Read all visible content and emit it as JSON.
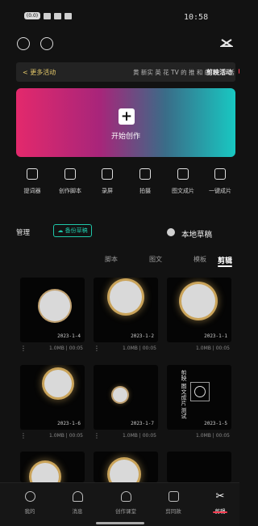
{
  "status_bar": {
    "time": "10:58",
    "icons": [
      "signal-icon",
      "wifi-icon",
      "battery-icon"
    ],
    "carrier_badge": "(0.0)"
  },
  "header": {
    "settings_icon": "settings-icon",
    "help_icon": "help-icon",
    "logo_icon": "capcut-logo-icon"
  },
  "notice": {
    "more_label": "< 更多活动",
    "message": "黄 新实 英 花 TV 的 推 和 的 我 手 活",
    "tag_label": "剪映活动"
  },
  "hero": {
    "create_label": "开始创作"
  },
  "tools": [
    {
      "label": "一键成片",
      "icon": "one-click-icon"
    },
    {
      "label": "图文成片",
      "icon": "text-to-video-icon"
    },
    {
      "label": "拍摄",
      "icon": "camera-icon"
    },
    {
      "label": "录屏",
      "icon": "screen-record-icon"
    },
    {
      "label": "创作脚本",
      "icon": "script-icon"
    },
    {
      "label": "提词器",
      "icon": "teleprompter-icon"
    }
  ],
  "drafts_section": {
    "title": "本地草稿",
    "cloud_label": "☁ 备份草稿",
    "manage_label": "管理"
  },
  "tabs": [
    "剪辑",
    "模板",
    "图文",
    "脚本"
  ],
  "active_tab": "剪辑",
  "drafts": [
    {
      "caption": "2023-1-1",
      "meta": "1.0MB | 00:05"
    },
    {
      "caption": "2023-1-2",
      "meta": "1.0MB | 00:05"
    },
    {
      "caption": "2023-1-4",
      "meta": "1.0MB | 00:05"
    },
    {
      "caption": "2023-1-5",
      "meta": "1.0MB | 00:05"
    },
    {
      "caption": "2023-1-7",
      "meta": "1.0MB | 00:05"
    },
    {
      "caption": "2023-1-6",
      "meta": "1.0MB | 00:05"
    }
  ],
  "doc_thumb_text": "剪映 图文成片 测试",
  "bottom_nav": [
    {
      "label": "剪辑",
      "icon": "scissors-icon"
    },
    {
      "label": "剪同款",
      "icon": "template-icon"
    },
    {
      "label": "创作课堂",
      "icon": "school-icon"
    },
    {
      "label": "消息",
      "icon": "bell-icon"
    },
    {
      "label": "我的",
      "icon": "profile-icon"
    }
  ],
  "accent_color": "#1fc6a8",
  "brand_color": "#ff3e53"
}
